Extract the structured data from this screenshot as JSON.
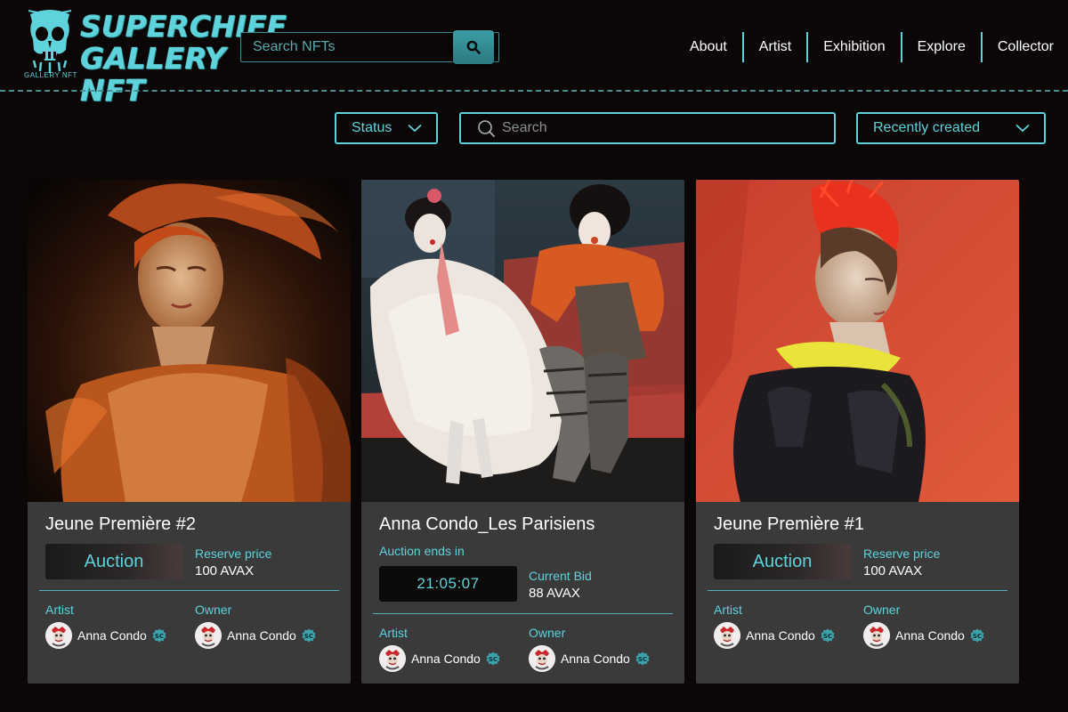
{
  "brand": {
    "logo_line1": "SUPERCHIEF",
    "logo_line2": "GALLERY NFT",
    "logo_sub": "GALLERY NFT",
    "accent": "#5fd3dc"
  },
  "header_search": {
    "placeholder": "Search NFTs",
    "button_icon": "search-icon"
  },
  "nav": {
    "items": [
      {
        "label": "About"
      },
      {
        "label": "Artist"
      },
      {
        "label": "Exhibition"
      },
      {
        "label": "Explore"
      },
      {
        "label": "Collector"
      }
    ]
  },
  "filters": {
    "status_label": "Status",
    "search_placeholder": "Search",
    "sort_label": "Recently created"
  },
  "cards": [
    {
      "title": "Jeune Première #2",
      "badge": "Auction",
      "price_label": "Reserve price",
      "price_value": "100 AVAX",
      "artist_label": "Artist",
      "artist_name": "Anna Condo",
      "owner_label": "Owner",
      "owner_name": "Anna Condo"
    },
    {
      "title": "Anna Condo_Les Parisiens",
      "ends_label": "Auction ends in",
      "timer": "21:05:07",
      "price_label": "Current Bid",
      "price_value": "88 AVAX",
      "artist_label": "Artist",
      "artist_name": "Anna Condo",
      "owner_label": "Owner",
      "owner_name": "Anna Condo"
    },
    {
      "title": "Jeune Première #1",
      "badge": "Auction",
      "price_label": "Reserve price",
      "price_value": "100 AVAX",
      "artist_label": "Artist",
      "artist_name": "Anna Condo",
      "owner_label": "Owner",
      "owner_name": "Anna Condo"
    }
  ]
}
